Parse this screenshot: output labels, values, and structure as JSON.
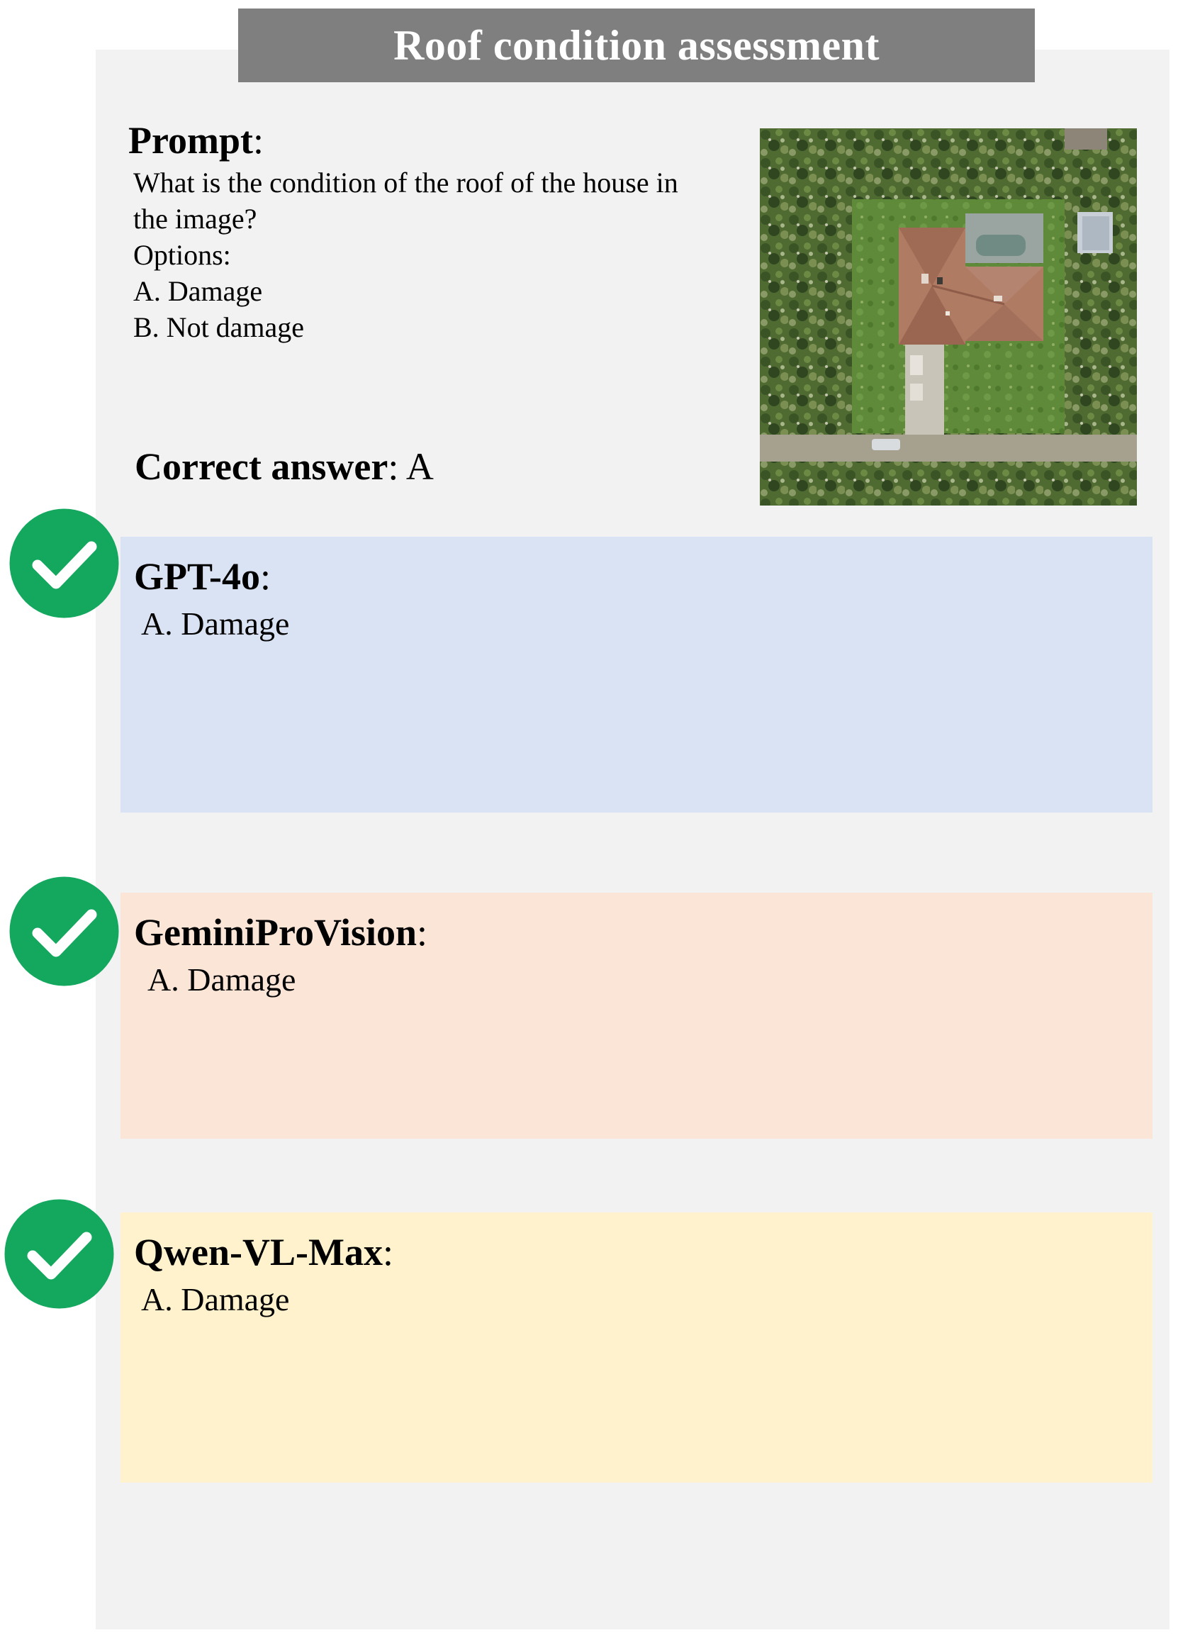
{
  "title": "Roof condition assessment",
  "prompt": {
    "heading": "Prompt",
    "heading_colon": ":",
    "lines": [
      "What is the condition of the roof of the house in",
      "the image?",
      "Options:",
      "A. Damage",
      "B. Not damage"
    ]
  },
  "correct_answer": {
    "label": "Correct answer",
    "colon": ":",
    "value": "A"
  },
  "responses": [
    {
      "model": "GPT-4o",
      "colon": ":",
      "answer": "A. Damage",
      "status": "correct",
      "color": "#dae3f3"
    },
    {
      "model": "GeminiProVision",
      "colon": ":",
      "answer": "A. Damage",
      "status": "correct",
      "color": "#fbe5d6"
    },
    {
      "model": "Qwen-VL-Max",
      "colon": ":",
      "answer": "A. Damage",
      "status": "correct",
      "color": "#fff2cc"
    }
  ],
  "icons": {
    "check": "check-circle-icon",
    "check_color": "#14a85f"
  }
}
